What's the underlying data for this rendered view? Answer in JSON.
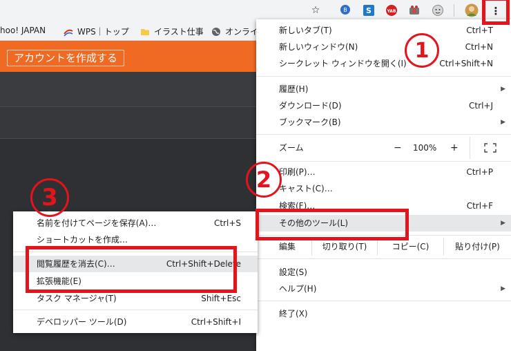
{
  "browser": {
    "toolbar_icons": [
      "star-icon",
      "extension-hatena-icon",
      "extension-s-icon",
      "extension-yab-icon",
      "extension-camera-icon",
      "extension-face-icon",
      "profile-avatar",
      "kebab-menu-icon"
    ],
    "menu_glyph": "⋮",
    "star_glyph": "☆"
  },
  "bookmarks": [
    {
      "label": "hoo! JAPAN"
    },
    {
      "label": "WPS｜トップ"
    },
    {
      "label": "イラスト仕事"
    },
    {
      "label": "オンライ"
    }
  ],
  "page": {
    "account_button": "アカウントを作成する"
  },
  "menu": {
    "new_tab": {
      "label": "新しいタブ(T)",
      "shortcut": "Ctrl+T"
    },
    "new_window": {
      "label": "新しいウィンドウ(N)",
      "shortcut": "Ctrl+N"
    },
    "incognito": {
      "label": "シークレット ウィンドウを開く(I)",
      "shortcut": "Ctrl+Shift+N"
    },
    "history": {
      "label": "履歴(H)"
    },
    "downloads": {
      "label": "ダウンロード(D)",
      "shortcut": "Ctrl+J"
    },
    "bookmarks": {
      "label": "ブックマーク(B)"
    },
    "zoom": {
      "label": "ズーム",
      "minus": "−",
      "value": "100%",
      "plus": "+"
    },
    "print": {
      "label": "印刷(P)…",
      "shortcut": "Ctrl+P"
    },
    "cast": {
      "label": "キャスト(C)…"
    },
    "find": {
      "label": "検索(F)…",
      "shortcut": "Ctrl+F"
    },
    "more_tools": {
      "label": "その他のツール(L)"
    },
    "edit": {
      "label": "編集",
      "cut": "切り取り(T)",
      "copy": "コピー(C)",
      "paste": "貼り付け(P)"
    },
    "settings": {
      "label": "設定(S)"
    },
    "help": {
      "label": "ヘルプ(H)"
    },
    "exit": {
      "label": "終了(X)"
    }
  },
  "submenu": {
    "save_page": {
      "label": "名前を付けてページを保存(A)…",
      "shortcut": "Ctrl+S"
    },
    "create_shortcut": {
      "label": "ショートカットを作成…"
    },
    "clear_data": {
      "label": "閲覧履歴を消去(C)…",
      "shortcut": "Ctrl+Shift+Delete"
    },
    "extensions": {
      "label": "拡張機能(E)"
    },
    "task_manager": {
      "label": "タスク マネージャ(T)",
      "shortcut": "Shift+Esc"
    },
    "dev_tools": {
      "label": "デベロッパー ツール(D)",
      "shortcut": "Ctrl+Shift+I"
    }
  },
  "annotations": {
    "step1": "1",
    "step2": "2",
    "step3": "3"
  },
  "colors": {
    "annotation_red": "#e4141d",
    "page_orange": "#f06a24"
  }
}
